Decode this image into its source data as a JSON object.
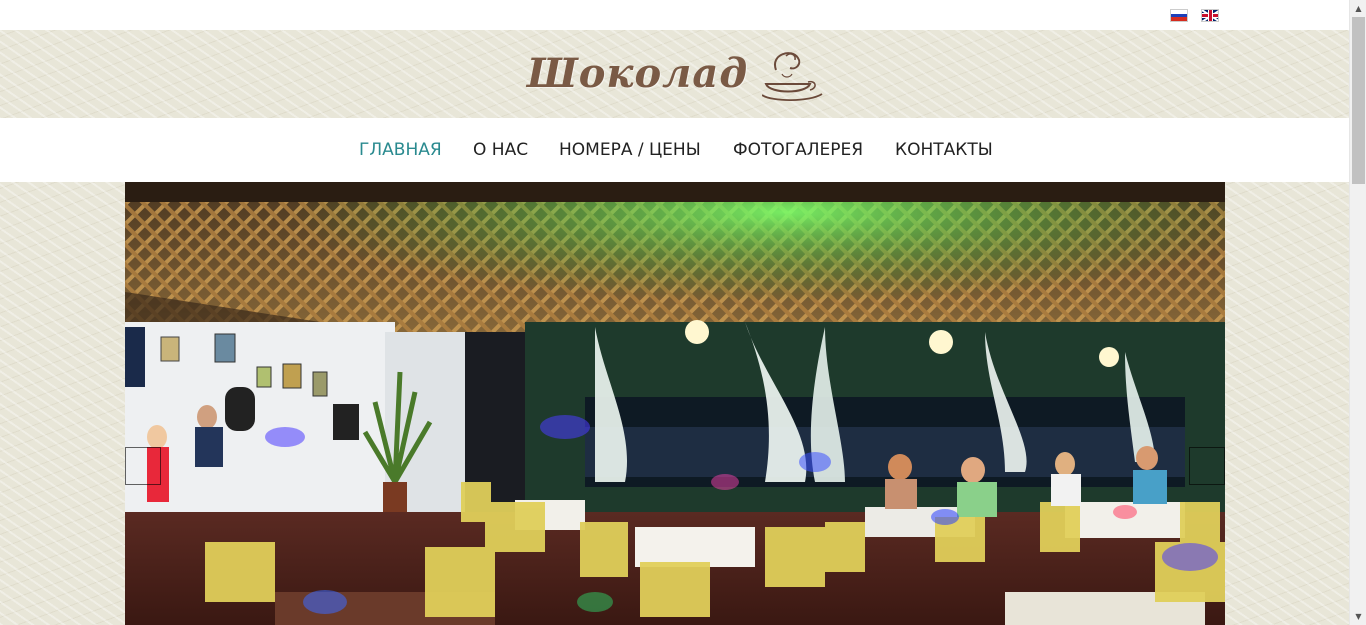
{
  "languages": [
    {
      "code": "ru",
      "label": "Русский"
    },
    {
      "code": "en",
      "label": "English"
    }
  ],
  "logo": {
    "text": "Шоколад",
    "icon": "coffee-cup-icon"
  },
  "nav": {
    "items": [
      {
        "label": "ГЛАВНАЯ",
        "active": true
      },
      {
        "label": "О НАС",
        "active": false
      },
      {
        "label": "НОМЕРА / ЦЕНЫ",
        "active": false
      },
      {
        "label": "ФОТОГАЛЕРЕЯ",
        "active": false
      },
      {
        "label": "КОНТАКТЫ",
        "active": false
      }
    ]
  },
  "colors": {
    "nav_active": "#2a8a8f",
    "nav_text": "#222222",
    "logo_brown": "#7a5a45",
    "background": "#e8e6d8"
  },
  "hero": {
    "icon": "cafe-terrace-photo"
  },
  "scrollbar": {
    "up_icon": "▲",
    "down_icon": "▼"
  }
}
